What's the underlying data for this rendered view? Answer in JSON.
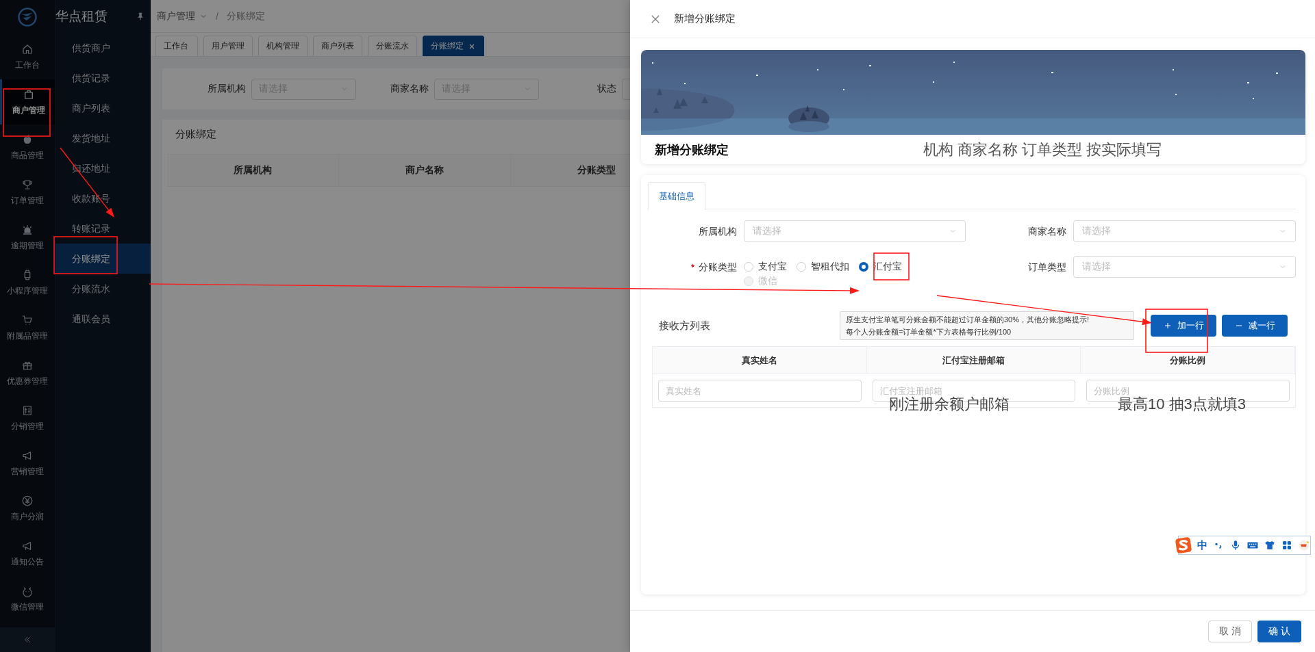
{
  "app": {
    "name": "华点租赁"
  },
  "rail": [
    {
      "label": "工作台",
      "selected": false
    },
    {
      "label": "商户管理",
      "selected": true
    },
    {
      "label": "商品管理",
      "selected": false
    },
    {
      "label": "订单管理",
      "selected": false
    },
    {
      "label": "逾期管理",
      "selected": false
    },
    {
      "label": "小程序管理",
      "selected": false
    },
    {
      "label": "附属品管理",
      "selected": false
    },
    {
      "label": "优惠券管理",
      "selected": false
    },
    {
      "label": "分销管理",
      "selected": false
    },
    {
      "label": "营销管理",
      "selected": false
    },
    {
      "label": "商户分润",
      "selected": false
    },
    {
      "label": "通知公告",
      "selected": false
    },
    {
      "label": "微信管理",
      "selected": false
    }
  ],
  "submenu": [
    {
      "label": "供货商户",
      "selected": false
    },
    {
      "label": "供货记录",
      "selected": false
    },
    {
      "label": "商户列表",
      "selected": false
    },
    {
      "label": "发货地址",
      "selected": false
    },
    {
      "label": "归还地址",
      "selected": false
    },
    {
      "label": "收款账号",
      "selected": false
    },
    {
      "label": "转账记录",
      "selected": false
    },
    {
      "label": "分账绑定",
      "selected": true
    },
    {
      "label": "分账流水",
      "selected": false
    },
    {
      "label": "通联会员",
      "selected": false
    }
  ],
  "breadcrumb": {
    "separator": "/",
    "items": [
      "商户管理",
      "分账绑定"
    ]
  },
  "page_tabs": [
    {
      "label": "工作台",
      "selected": false
    },
    {
      "label": "用户管理",
      "selected": false
    },
    {
      "label": "机构管理",
      "selected": false
    },
    {
      "label": "商户列表",
      "selected": false
    },
    {
      "label": "分账流水",
      "selected": false
    },
    {
      "label": "分账绑定",
      "selected": true
    }
  ],
  "filters": [
    {
      "label": "所属机构",
      "placeholder": "请选择"
    },
    {
      "label": "商家名称",
      "placeholder": "请选择"
    },
    {
      "label": "状态"
    }
  ],
  "list": {
    "title": "分账绑定",
    "columns": [
      "所属机构",
      "商户名称",
      "分账类型"
    ]
  },
  "drawer": {
    "title": "新增分账绑定",
    "banner_title": "新增分账绑定",
    "tabs": [
      {
        "label": "基础信息",
        "selected": true
      }
    ],
    "fields": [
      {
        "kind": "select",
        "label": "所属机构",
        "placeholder": "请选择"
      },
      {
        "kind": "select",
        "label": "商家名称",
        "placeholder": "请选择"
      },
      {
        "kind": "radio",
        "label": "分账类型",
        "required": true,
        "options": [
          {
            "label": "支付宝",
            "selected": false,
            "disabled": false
          },
          {
            "label": "智租代扣",
            "selected": false,
            "disabled": false
          },
          {
            "label": "汇付宝",
            "selected": true,
            "disabled": false
          },
          {
            "label": "微信",
            "selected": false,
            "disabled": true
          }
        ]
      },
      {
        "kind": "select",
        "label": "订单类型",
        "placeholder": "请选择"
      }
    ],
    "receivers": {
      "title": "接收方列表",
      "tip": [
        "原生支付宝单笔可分账金额不能超过订单金额的30%，其他分账忽略提示!",
        "每个人分账金额=订单金额*下方表格每行比例/100"
      ],
      "buttons": [
        {
          "kind": "add",
          "label": "加一行"
        },
        {
          "kind": "remove",
          "label": "减一行"
        }
      ],
      "columns": [
        "真实姓名",
        "汇付宝注册邮箱",
        "分账比例"
      ],
      "rows": [
        [
          {
            "placeholder": "真实姓名"
          },
          {
            "placeholder": "汇付宝注册邮箱"
          },
          {
            "placeholder": "分账比例"
          }
        ]
      ]
    },
    "footer_buttons": [
      {
        "kind": "default",
        "label": "取 消"
      },
      {
        "kind": "primary",
        "label": "确 认"
      }
    ]
  },
  "annotations": {
    "banner_note": "机构 商家名称 订单类型 按实际填写",
    "column_notes": [
      "刚注册余额户邮箱",
      "最高10 抽3点就填3"
    ]
  },
  "ime_toolbar": {
    "mode": "中"
  }
}
